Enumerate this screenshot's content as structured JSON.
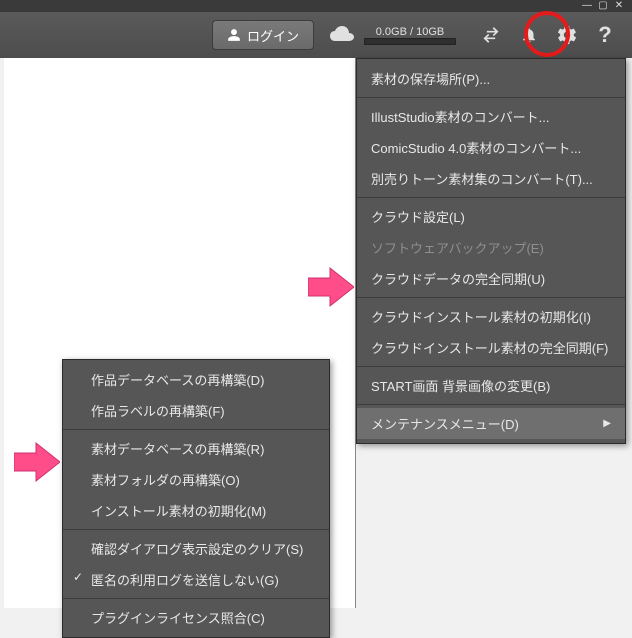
{
  "window": {
    "min": "—",
    "max": "▢",
    "close": "✕"
  },
  "toolbar": {
    "login_label": "ログイン",
    "storage_text": "0.0GB / 10GB"
  },
  "settings_menu": {
    "items": [
      {
        "label": "素材の保存場所(P)..."
      },
      {
        "sep": true
      },
      {
        "label": "IllustStudio素材のコンバート..."
      },
      {
        "label": "ComicStudio  4.0素材のコンバート..."
      },
      {
        "label": "別売りトーン素材集のコンバート(T)..."
      },
      {
        "sep": true
      },
      {
        "label": "クラウド設定(L)"
      },
      {
        "label": "ソフトウェアバックアップ(E)",
        "disabled": true
      },
      {
        "label": "クラウドデータの完全同期(U)"
      },
      {
        "sep": true
      },
      {
        "label": "クラウドインストール素材の初期化(I)"
      },
      {
        "label": "クラウドインストール素材の完全同期(F)"
      },
      {
        "sep": true
      },
      {
        "label": "START画面 背景画像の変更(B)"
      },
      {
        "sep": true
      },
      {
        "label": "メンテナンスメニュー(D)",
        "active": true
      }
    ]
  },
  "maintenance_submenu": {
    "items": [
      {
        "label": "作品データベースの再構築(D)"
      },
      {
        "label": "作品ラベルの再構築(F)"
      },
      {
        "sep": true
      },
      {
        "label": "素材データベースの再構築(R)"
      },
      {
        "label": "素材フォルダの再構築(O)"
      },
      {
        "label": "インストール素材の初期化(M)"
      },
      {
        "sep": true
      },
      {
        "label": "確認ダイアログ表示設定のクリア(S)"
      },
      {
        "label": "匿名の利用ログを送信しない(G)",
        "check": true
      },
      {
        "sep": true
      },
      {
        "label": "プラグインライセンス照合(C)"
      }
    ]
  }
}
